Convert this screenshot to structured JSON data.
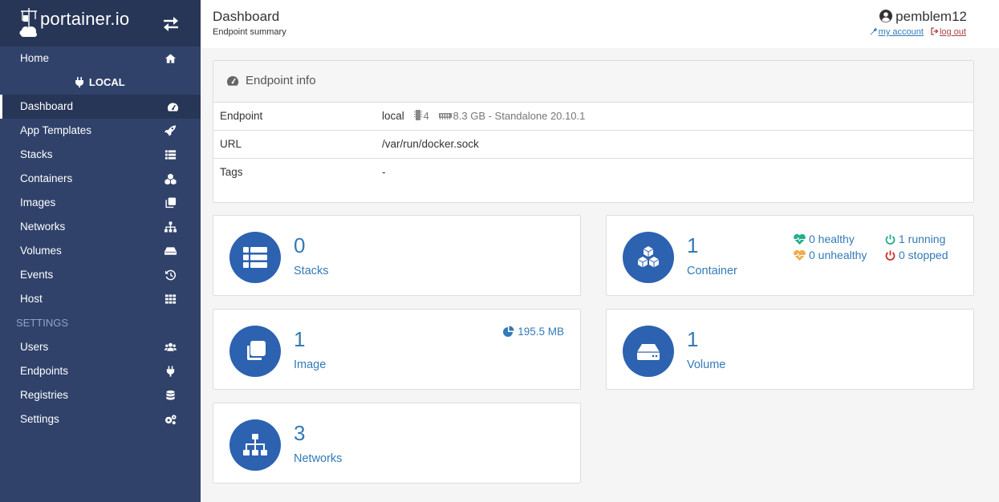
{
  "brand": {
    "name": "portainer.io"
  },
  "sidebar": {
    "items_top": [
      {
        "label": "Home",
        "icon": "home-icon"
      }
    ],
    "endpoint_label": "LOCAL",
    "items_endpoint": [
      {
        "label": "Dashboard",
        "icon": "tachometer-icon",
        "active": true
      },
      {
        "label": "App Templates",
        "icon": "rocket-icon"
      },
      {
        "label": "Stacks",
        "icon": "th-list-icon"
      },
      {
        "label": "Containers",
        "icon": "cubes-icon"
      },
      {
        "label": "Images",
        "icon": "clone-icon"
      },
      {
        "label": "Networks",
        "icon": "sitemap-icon"
      },
      {
        "label": "Volumes",
        "icon": "hdd-icon"
      },
      {
        "label": "Events",
        "icon": "history-icon"
      },
      {
        "label": "Host",
        "icon": "th-icon"
      }
    ],
    "settings_heading": "SETTINGS",
    "items_settings": [
      {
        "label": "Users",
        "icon": "users-icon"
      },
      {
        "label": "Endpoints",
        "icon": "plug-icon"
      },
      {
        "label": "Registries",
        "icon": "database-icon"
      },
      {
        "label": "Settings",
        "icon": "cogs-icon"
      }
    ]
  },
  "header": {
    "title": "Dashboard",
    "subtitle": "Endpoint summary",
    "username": "pemblem12",
    "my_account": "my account",
    "log_out": "log out"
  },
  "endpoint_info": {
    "title": "Endpoint info",
    "rows": {
      "endpoint": {
        "label": "Endpoint",
        "name": "local",
        "cpu": "4",
        "memory_info": "8.3 GB - Standalone 20.10.1"
      },
      "url": {
        "label": "URL",
        "value": "/var/run/docker.sock"
      },
      "tags": {
        "label": "Tags",
        "value": "-"
      }
    }
  },
  "widgets": {
    "stacks": {
      "count": "0",
      "label": "Stacks"
    },
    "containers": {
      "count": "1",
      "label": "Container",
      "healthy": "0 healthy",
      "unhealthy": "0 unhealthy",
      "running": "1 running",
      "stopped": "0 stopped"
    },
    "images": {
      "count": "1",
      "label": "Image",
      "size": "195.5 MB"
    },
    "volumes": {
      "count": "1",
      "label": "Volume"
    },
    "networks": {
      "count": "3",
      "label": "Networks"
    }
  },
  "colors": {
    "sidebar": "#30426a",
    "sidebar_dark": "#273657",
    "accent": "#2c62b0",
    "link": "#337ab7",
    "healthy": "#23ae89",
    "unhealthy": "#f0ad4e",
    "running": "#23ae89",
    "stopped": "#c9302c"
  }
}
